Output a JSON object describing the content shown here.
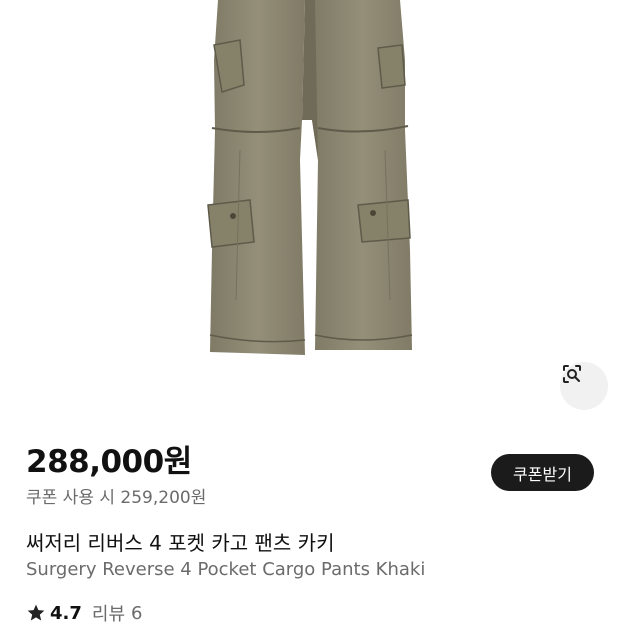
{
  "product": {
    "price": "288,000원",
    "coupon_price": "쿠폰 사용 시 259,200원",
    "coupon_button": "쿠폰받기",
    "title_ko": "써저리 리버스 4 포켓 카고 팬츠 카키",
    "title_en": "Surgery Reverse 4 Pocket Cargo Pants Khaki",
    "rating": "4.7",
    "review_label": "리뷰",
    "review_count": "6"
  },
  "icons": {
    "lens": "lens-search-icon",
    "rating": "star-icon"
  },
  "colors": {
    "khaki": "#8e8a75",
    "button_bg": "#1b1b1b",
    "secondary_text": "#6b6b6b"
  }
}
